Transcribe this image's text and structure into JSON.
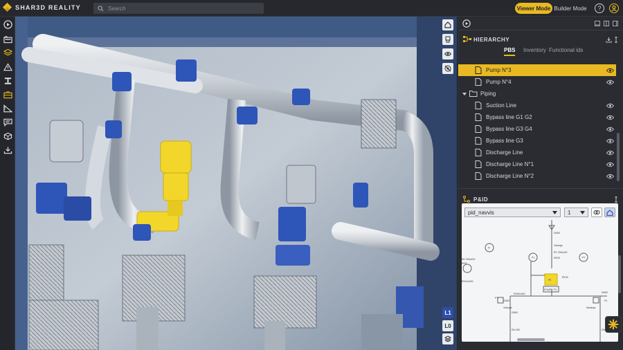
{
  "app": {
    "name": "SHAR3D REALITY"
  },
  "search": {
    "placeholder": "Search"
  },
  "modes": {
    "viewer": "Viewer Mode",
    "builder": "Builder Mode",
    "active": "viewer"
  },
  "colors": {
    "accent": "#e8b923",
    "selected_equipment": "#f2d72a",
    "pump_blue": "#2e55b8"
  },
  "topbar": {
    "help_icon": "?",
    "user_icon": "user-circle-icon"
  },
  "toolbar": {
    "items": [
      "play-icon",
      "building-icon",
      "layers-icon",
      "warning-icon",
      "beam-icon",
      "toolbox-icon",
      "ruler-icon",
      "comment-icon",
      "cube-icon",
      "download-icon"
    ]
  },
  "viewport": {
    "right_buttons": [
      "home-icon",
      "pump-icon",
      "eye-icon",
      "eye-off-icon"
    ],
    "level_buttons": [
      "L1",
      "L0"
    ],
    "active_level": "L1",
    "layers_icon": "layers-icon"
  },
  "hierarchy": {
    "title": "HIERARCHY",
    "tabs": [
      "PBS",
      "Inventory",
      "Functional ids"
    ],
    "active_tab": "PBS",
    "rows": [
      {
        "label": "Pump N°3",
        "type": "doc",
        "selected": true
      },
      {
        "label": "Pump N°4",
        "type": "doc",
        "selected": false
      },
      {
        "label": "Piping",
        "type": "folder",
        "selected": false
      },
      {
        "label": "Suction Line",
        "type": "doc",
        "selected": false
      },
      {
        "label": "Bypass line G1 G2",
        "type": "doc",
        "selected": false
      },
      {
        "label": "Bypass line G3 G4",
        "type": "doc",
        "selected": false
      },
      {
        "label": "Bypass line G3",
        "type": "doc",
        "selected": false
      },
      {
        "label": "Discharge Line",
        "type": "doc",
        "selected": false
      },
      {
        "label": "Discharge Line N°1",
        "type": "doc",
        "selected": false
      },
      {
        "label": "Discharge Line N°2",
        "type": "doc",
        "selected": false
      }
    ]
  },
  "pid": {
    "title": "P&ID",
    "document_select": "pid_navvis",
    "page_select": "1",
    "diagram_labels": [
      "DN50",
      "Vidange",
      "RC 250x400",
      "DN15",
      "FI",
      "P3",
      "P1",
      "PT",
      "RH50x300",
      "Vidange",
      "DN50",
      "PT",
      "POMPE P3",
      "DN50",
      "RH10x300",
      "RE 250x400",
      "RHS",
      "DN 250",
      "DN 250",
      "Nedarge",
      "RE40",
      "DN50",
      "P2"
    ]
  },
  "fab": {
    "icon": "sparkle-icon"
  }
}
